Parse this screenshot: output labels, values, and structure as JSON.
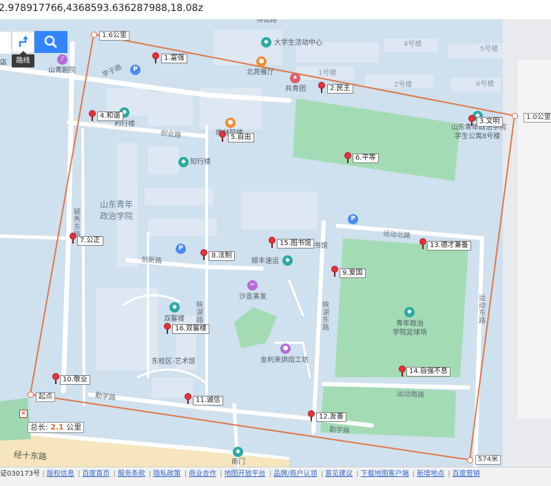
{
  "url_text": "2.978917766,4368593.636287988,18.08z",
  "toolbar": {
    "route_label": "路线",
    "partial_left_text": "店",
    "route_icon": "route-arrow-icon",
    "search_icon": "magnifier-icon"
  },
  "colors": {
    "route_line": "#e06a33",
    "pin": "#e5323b",
    "water_bg": "#cfe0ee",
    "green": "#a3dcb4",
    "search_blue": "#3385ff"
  },
  "distances": {
    "d1": "1.6公里",
    "d2": "1.0公里",
    "d3": "574米"
  },
  "start_label": "起点",
  "total": {
    "prefix": "总长:",
    "value": "2.1",
    "unit": "公里"
  },
  "markers": {
    "m1": "1.富强",
    "m2": "2.民主",
    "m3": "3.文明",
    "m4": "4.和谐",
    "m5": "5.自由",
    "m6": "6.平等",
    "m7": "7.公正",
    "m8": "8.法制",
    "m9": "9.爱国",
    "m10": "10.敬业",
    "m11": "11.诚信",
    "m12": "12.友善",
    "m13": "13.德才兼备",
    "m14": "14.自强不息",
    "m15": "15.图书馆",
    "m16": "16.双馨楼"
  },
  "places": {
    "student_center": "大学生活动中心",
    "beiyuan": "北苑餐厅",
    "gongqingtuan": "共青团",
    "shanqing_theater": "山青剧院",
    "lixing": "利行楼",
    "zhixing": "知行楼",
    "weike": "维林院楼",
    "school_line1": "山东青年",
    "school_line2": "政治学院",
    "dorm_line1": "山东青年政治学院",
    "dorm_line2": "学生公寓8号楼",
    "library": "东校区-图书馆",
    "shunfeng": "顺丰速运",
    "shayi": "沙宣美发",
    "shuangxin": "双馨楼",
    "art": "东校区-艺术馆",
    "bakery": "金利来烘焙工坊",
    "stadium_line1": "青年政治",
    "stadium_line2": "学院足球场",
    "south_gate": "南门"
  },
  "buildings": {
    "b1": "1号楼",
    "b2": "2号楼",
    "b4": "4号楼",
    "b5": "5号楼",
    "b6": "6号楼"
  },
  "roads": {
    "xuezi": "学子路",
    "chuangye": "创业路",
    "chuangxin": "创新路",
    "qinxue1": "勤学路",
    "qinxue2": "勤学路",
    "yunbei": "运动北路",
    "yunnan": "运动南路",
    "yundong": "运动东路",
    "yinghu": "映湖路",
    "yinghudong": "映湖东路",
    "ruixiu": "毓秀东路",
    "jingshi": "经十东路",
    "top_partial": "博德路"
  },
  "footer": {
    "links": [
      "证030173号",
      "版权信息",
      "百度首页",
      "服务条款",
      "隐私政策",
      "商业合作",
      "地图开放平台",
      "品牌/商户认领",
      "意见建议",
      "下载地图客户端",
      "新增地点",
      "百度营销"
    ]
  }
}
